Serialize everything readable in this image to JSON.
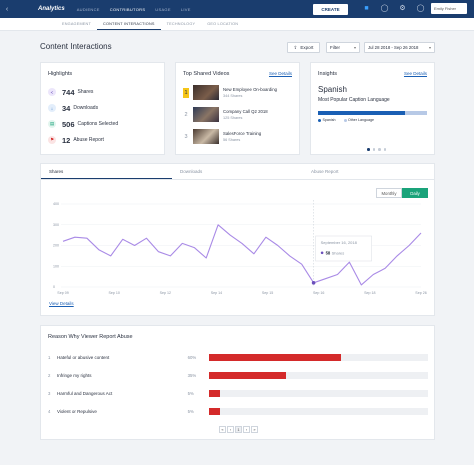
{
  "topbar": {
    "home_icon": "grid-menu-icon",
    "brand": "Analytics",
    "nav": [
      "AUDIENCE",
      "CONTRIBUTORS",
      "USAGE",
      "LIVE"
    ],
    "active_nav": 1,
    "create_label": "CREATE",
    "icons": [
      "folder-icon",
      "user-icon",
      "gear-icon",
      "help-icon"
    ],
    "user_name": "Emily Fisher"
  },
  "subtabs": {
    "items": [
      "ENGAGEMENT",
      "CONTENT INTERACTIONS",
      "TECHNOLOGY",
      "GEO LOCATION"
    ],
    "active": 1
  },
  "header": {
    "title": "Content Interactions",
    "export_label": "Export",
    "filter_label": "Filter",
    "date_range": "Jul 28 2018 - Sep 26 2018"
  },
  "highlights": {
    "title": "Highlights",
    "items": [
      {
        "value": "744",
        "label": "Shares",
        "icon": "share-icon",
        "color": "#6b4fbb"
      },
      {
        "value": "34",
        "label": "Downloads",
        "icon": "download-icon",
        "color": "#1a5fb4"
      },
      {
        "value": "506",
        "label": "Captions Selected",
        "icon": "captions-icon",
        "color": "#1aa37a"
      },
      {
        "value": "12",
        "label": "Abuse Report",
        "icon": "flag-icon",
        "color": "#d42a2a"
      }
    ]
  },
  "top_videos": {
    "title": "Top Shared Videos",
    "see_details": "See Details",
    "items": [
      {
        "rank": "1",
        "title": "New Employee On-boarding",
        "shares": "344 Shares"
      },
      {
        "rank": "2",
        "title": "Company Call Q2 2018",
        "shares": "125 Shares"
      },
      {
        "rank": "3",
        "title": "SalesForce Training",
        "shares": "56 Shares"
      }
    ]
  },
  "insights": {
    "title": "Insights",
    "see_details": "See Details",
    "language": "Spanish",
    "subtitle": "Most Popular Caption Language",
    "spanish_share": 0.8,
    "legend": [
      {
        "label": "Spanish",
        "color": "#1a5fb4"
      },
      {
        "label": "Other Language",
        "color": "#b7c9e6"
      }
    ],
    "pages": 4,
    "active_page": 0
  },
  "chart_tabs": {
    "items": [
      "Shares",
      "Downloads",
      "Abuse Report"
    ],
    "active": 0,
    "toggle": [
      "Monthly",
      "Daily"
    ],
    "toggle_active": 1,
    "view_details": "View Details"
  },
  "chart_data": {
    "type": "line",
    "title": "",
    "xlabel": "",
    "ylabel": "",
    "ylim": [
      0,
      400
    ],
    "yticks": [
      0,
      100,
      200,
      300,
      400
    ],
    "xticks": [
      "Sep 09",
      "Sep 10",
      "Sep 12",
      "Sep 14",
      "Sep 15",
      "Sep 16",
      "Sep 18",
      "Sep 26"
    ],
    "series": [
      {
        "values": [
          220,
          240,
          235,
          180,
          150,
          230,
          200,
          235,
          170,
          150,
          210,
          190,
          140,
          300,
          250,
          210,
          160,
          240,
          200,
          150,
          110,
          20,
          40,
          60,
          120,
          10,
          60,
          90,
          150,
          200,
          260
        ]
      }
    ],
    "color": "#a98ae6",
    "tooltip": {
      "date": "September 16, 2018",
      "value": "58",
      "label": "Shares",
      "index": 21
    }
  },
  "abuse": {
    "title": "Reason Why Viewer Report Abuse",
    "rows": [
      {
        "num": "1",
        "label": "Hateful or abusive content",
        "pct_label": "60%",
        "pct": 60
      },
      {
        "num": "2",
        "label": "Infringe my rights",
        "pct_label": "35%",
        "pct": 35
      },
      {
        "num": "3",
        "label": "Harmful and Dangerous Act",
        "pct_label": "5%",
        "pct": 5
      },
      {
        "num": "4",
        "label": "Violent or Repulsive",
        "pct_label": "5%",
        "pct": 5
      }
    ],
    "pager": [
      "«",
      "‹",
      "1",
      "›",
      "»"
    ],
    "pager_active": 2
  }
}
